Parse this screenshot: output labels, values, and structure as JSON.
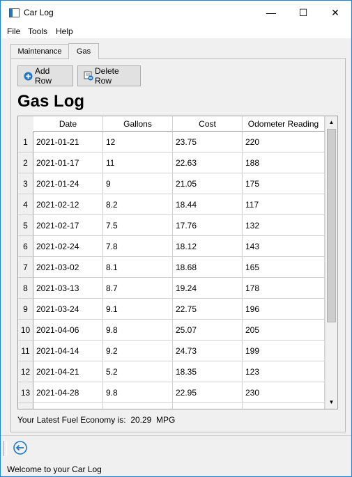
{
  "window": {
    "title": "Car Log",
    "controls": {
      "minimize": "—",
      "maximize": "☐",
      "close": "✕"
    }
  },
  "menu": {
    "items": [
      "File",
      "Tools",
      "Help"
    ]
  },
  "tabs": [
    {
      "label": "Maintenance",
      "active": false
    },
    {
      "label": "Gas",
      "active": true
    }
  ],
  "toolbar": {
    "add_label": "Add Row",
    "delete_label": "Delete Row"
  },
  "heading": "Gas Log",
  "table": {
    "columns": [
      "Date",
      "Gallons",
      "Cost",
      "Odometer Reading"
    ],
    "rows": [
      [
        "1",
        "2021-01-21",
        "12",
        "23.75",
        "220"
      ],
      [
        "2",
        "2021-01-17",
        "11",
        "22.63",
        "188"
      ],
      [
        "3",
        "2021-01-24",
        "9",
        "21.05",
        "175"
      ],
      [
        "4",
        "2021-02-12",
        "8.2",
        "18.44",
        "117"
      ],
      [
        "5",
        "2021-02-17",
        "7.5",
        "17.76",
        "132"
      ],
      [
        "6",
        "2021-02-24",
        "7.8",
        "18.12",
        "143"
      ],
      [
        "7",
        "2021-03-02",
        "8.1",
        "18.68",
        "165"
      ],
      [
        "8",
        "2021-03-13",
        "8.7",
        "19.24",
        "178"
      ],
      [
        "9",
        "2021-03-24",
        "9.1",
        "22.75",
        "196"
      ],
      [
        "10",
        "2021-04-06",
        "9.8",
        "25.07",
        "205"
      ],
      [
        "11",
        "2021-04-14",
        "9.2",
        "24.73",
        "199"
      ],
      [
        "12",
        "2021-04-21",
        "5.2",
        "18.35",
        "123"
      ],
      [
        "13",
        "2021-04-28",
        "9.8",
        "22.95",
        "230"
      ],
      [
        "",
        "",
        "",
        "",
        ""
      ]
    ]
  },
  "economy": {
    "label": "Your Latest Fuel Economy is:",
    "value": "20.29",
    "unit": "MPG"
  },
  "status": "Welcome to your Car Log",
  "colors": {
    "accent": "#1883d7",
    "add_icon": "#1e76c8"
  }
}
